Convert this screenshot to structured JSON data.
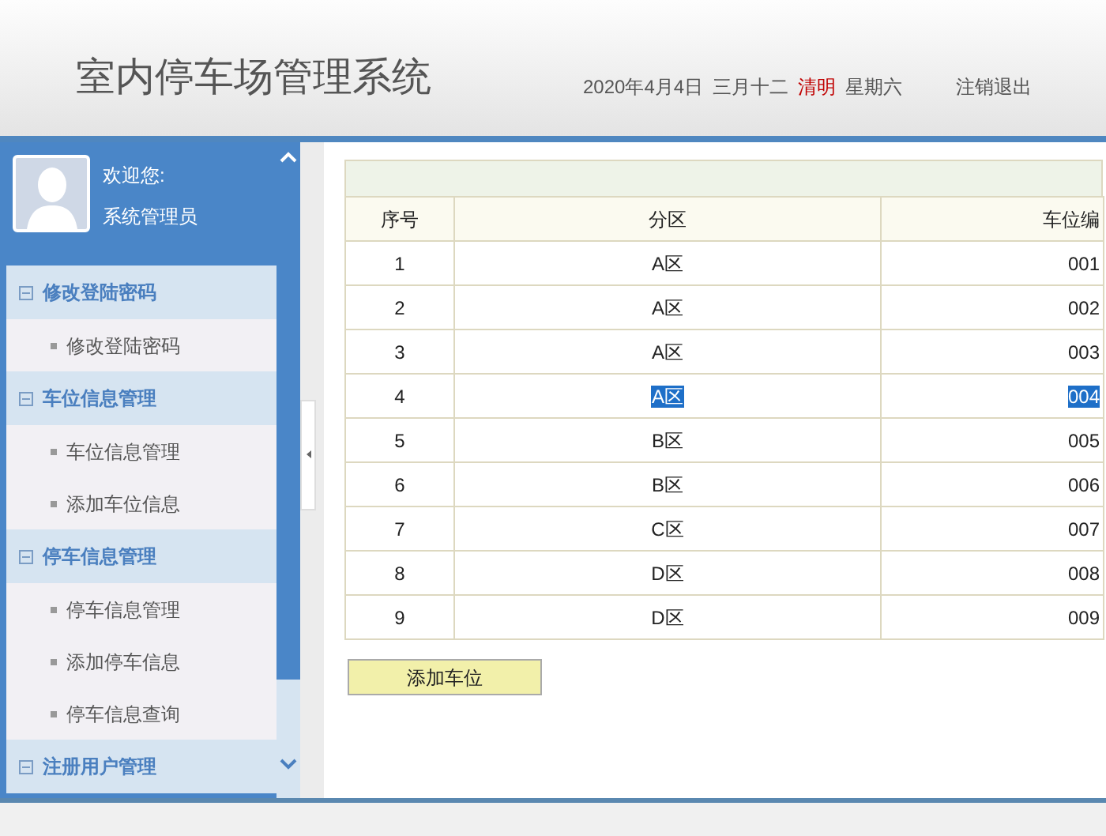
{
  "header": {
    "title": "室内停车场管理系统",
    "date": "2020年4月4日",
    "lunar_date": "三月十二",
    "solar_term": "清明",
    "weekday": "星期六",
    "logout": "注销退出"
  },
  "user": {
    "greeting": "欢迎您:",
    "name": "系统管理员"
  },
  "sidebar": {
    "groups": [
      {
        "label": "修改登陆密码",
        "expanded": true,
        "children": [
          {
            "label": "修改登陆密码"
          }
        ]
      },
      {
        "label": "车位信息管理",
        "expanded": true,
        "children": [
          {
            "label": "车位信息管理"
          },
          {
            "label": "添加车位信息"
          }
        ]
      },
      {
        "label": "停车信息管理",
        "expanded": true,
        "children": [
          {
            "label": "停车信息管理"
          },
          {
            "label": "添加停车信息"
          },
          {
            "label": "停车信息查询"
          }
        ]
      },
      {
        "label": "注册用户管理",
        "expanded": true
      }
    ]
  },
  "table": {
    "columns": [
      "序号",
      "分区",
      "车位编"
    ],
    "rows": [
      {
        "cells": [
          "1",
          "A区",
          "001"
        ],
        "selected": false
      },
      {
        "cells": [
          "2",
          "A区",
          "002"
        ],
        "selected": false
      },
      {
        "cells": [
          "3",
          "A区",
          "003"
        ],
        "selected": false
      },
      {
        "cells": [
          "4",
          "A区",
          "004"
        ],
        "selected": true
      },
      {
        "cells": [
          "5",
          "B区",
          "005"
        ],
        "selected": false
      },
      {
        "cells": [
          "6",
          "B区",
          "006"
        ],
        "selected": false
      },
      {
        "cells": [
          "7",
          "C区",
          "007"
        ],
        "selected": false
      },
      {
        "cells": [
          "8",
          "D区",
          "008"
        ],
        "selected": false
      },
      {
        "cells": [
          "9",
          "D区",
          "009"
        ],
        "selected": false
      }
    ]
  },
  "add_button": "添加车位"
}
